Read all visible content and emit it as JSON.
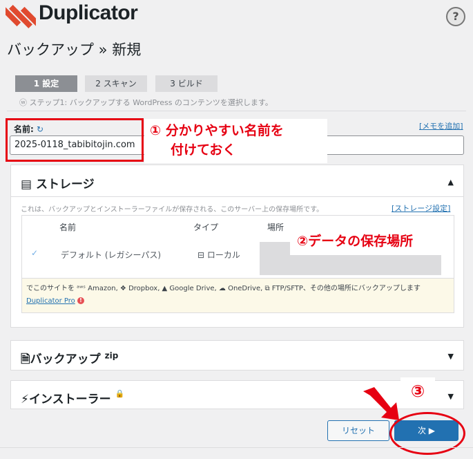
{
  "header": {
    "brand": "Duplicator",
    "help": "?",
    "title": "バックアップ » 新規"
  },
  "steps": [
    {
      "label": "1 設定"
    },
    {
      "label": "2 スキャン"
    },
    {
      "label": "3 ビルド"
    }
  ],
  "step_note": "ステップ1: バックアップする WordPress のコンテンツを選択します。",
  "name_field": {
    "label": "名前:",
    "value": "2025-0118_tabibitojin.com",
    "memo_link": "[メモを追加]"
  },
  "annotations": {
    "a1_line1": "① 分かりやすい名前を",
    "a1_line2": "付けておく",
    "a2": "②データの保存場所",
    "a3": "③"
  },
  "storage": {
    "title": "ストレージ",
    "note": "これは、バックアップとインストーラーファイルが保存される、このサーバー上の保存場所です。",
    "settings_link": "[ストレージ設定]",
    "columns": [
      "名前",
      "タイプ",
      "場所"
    ],
    "row": {
      "name": "デフォルト (レガシーパス)",
      "type": "ローカル"
    },
    "promo_text": "でこのサイトを ᵃʷˢ Amazon, ❖ Dropbox, ▲ Google Drive, ☁ OneDrive, ⧉ FTP/SFTP、その他の場所にバックアップします",
    "promo_link": "Duplicator Pro"
  },
  "zip_panel": {
    "title": "バックアップ",
    "sup": "zip"
  },
  "installer_panel": {
    "title": "インストーラー"
  },
  "buttons": {
    "reset": "リセット",
    "next": "次 ▶"
  },
  "colors": {
    "accent": "#2271b1",
    "brand": "#e04a2f",
    "annotation": "#e60012"
  },
  "icons": {
    "logo": "duplicator-logo",
    "storage": "server-icon",
    "zip": "file-zip-icon",
    "installer": "bolt-icon",
    "lock": "lock-icon",
    "refresh": "refresh-icon"
  }
}
